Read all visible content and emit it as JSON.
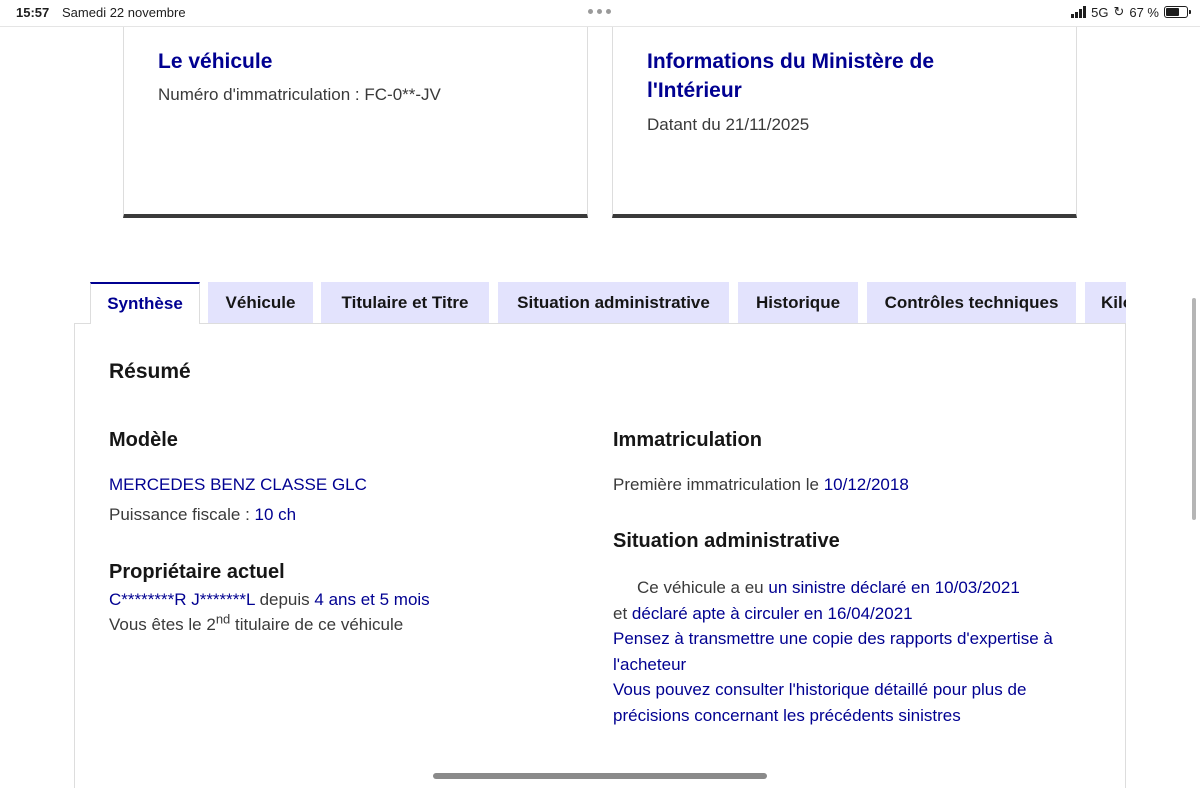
{
  "status_bar": {
    "time": "15:57",
    "date": "Samedi 22 novembre",
    "network": "5G",
    "battery": "67 %",
    "battery_level": 0.67
  },
  "vehicle_card": {
    "title": "Le véhicule",
    "registration": "Numéro d'immatriculation : FC-0**-JV"
  },
  "ministry_card": {
    "title": "Informations du Ministère de l'Intérieur",
    "dated": "Datant du 21/11/2025"
  },
  "tabs": [
    {
      "label": "Synthèse",
      "active": true
    },
    {
      "label": "Véhicule"
    },
    {
      "label": "Titulaire et Titre"
    },
    {
      "label": "Situation administrative"
    },
    {
      "label": "Historique"
    },
    {
      "label": "Contrôles techniques"
    },
    {
      "label": "Kilométrage"
    }
  ],
  "summary": {
    "title": "Résumé",
    "model": {
      "heading": "Modèle",
      "name": "MERCEDES BENZ CLASSE GLC",
      "power_label": "Puissance fiscale : ",
      "power_value": "10 ch"
    },
    "owner": {
      "heading": "Propriétaire actuel",
      "name": "C********R J*******L",
      "since_label": " depuis ",
      "since_value": "4 ans et 5 mois",
      "rank_prefix": "Vous êtes le 2",
      "rank_sup": "nd",
      "rank_suffix": " titulaire de ce véhicule"
    },
    "registration": {
      "heading": "Immatriculation",
      "first_label": "Première immatriculation le ",
      "first_value": "10/12/2018"
    },
    "admin": {
      "heading": "Situation administrative",
      "intro": "Ce véhicule a eu ",
      "sinistre": "un sinistre déclaré en 10/03/2021",
      "and": "et ",
      "apte": "déclaré apte à circuler en 16/04/2021",
      "transmit": "Pensez à transmettre une copie des rapports d'expertise à l'acheteur",
      "history": "Vous pouvez consulter l'historique détaillé pour plus de précisions concernant les précédents sinistres"
    }
  }
}
